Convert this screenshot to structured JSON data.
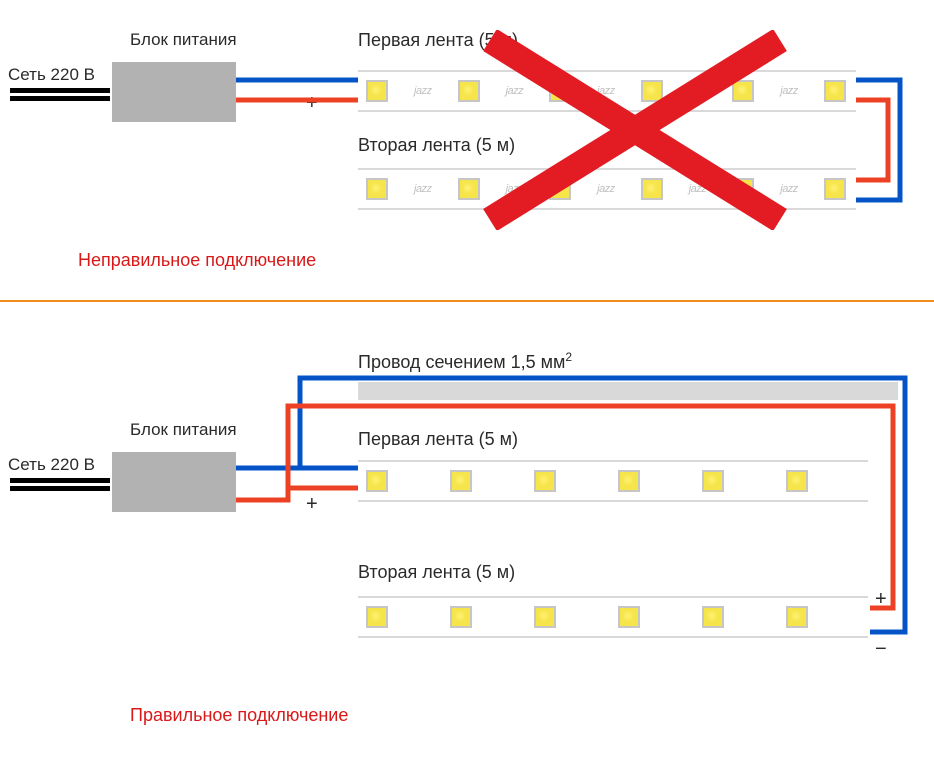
{
  "top": {
    "psu_label": "Блок питания",
    "mains_label": "Сеть 220 В",
    "strip1_label": "Первая лента (5 м)",
    "strip2_label": "Вторая лента (5 м)",
    "caption": "Неправильное подключение",
    "minus": "−",
    "plus": "+",
    "brand": "jazz"
  },
  "bottom": {
    "psu_label": "Блок питания",
    "mains_label": "Сеть 220 В",
    "wire_label_html": "Провод сечением 1,5 мм",
    "wire_label_sup": "2",
    "strip1_label": "Первая лента (5 м)",
    "strip2_label": "Вторая лента (5 м)",
    "caption": "Правильное подключение",
    "minus": "−",
    "plus": "+"
  }
}
